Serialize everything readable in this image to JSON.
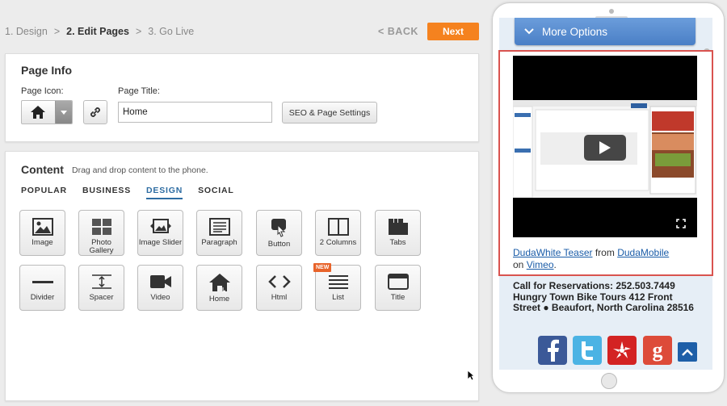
{
  "steps": {
    "step1": "1. Design",
    "sep1": ">",
    "step2": "2. Edit Pages",
    "sep2": ">",
    "step3": "3. Go Live"
  },
  "nav": {
    "back": "< BACK",
    "next": "Next"
  },
  "page_info": {
    "title": "Page Info",
    "icon_label": "Page Icon:",
    "title_label": "Page Title:",
    "title_value": "Home",
    "seo_button": "SEO & Page Settings"
  },
  "content": {
    "title": "Content",
    "subtitle": "Drag and drop content to the phone.",
    "tabs": [
      "POPULAR",
      "BUSINESS",
      "DESIGN",
      "SOCIAL"
    ],
    "active_tab": "DESIGN",
    "widgets": [
      {
        "label": "Image",
        "icon": "image-icon"
      },
      {
        "label": "Photo Gallery",
        "icon": "photo-gallery-icon"
      },
      {
        "label": "Image Slider",
        "icon": "image-slider-icon"
      },
      {
        "label": "Paragraph",
        "icon": "paragraph-icon"
      },
      {
        "label": "Button",
        "icon": "button-hand-icon"
      },
      {
        "label": "2 Columns",
        "icon": "two-columns-icon"
      },
      {
        "label": "Tabs",
        "icon": "tabs-icon"
      },
      {
        "label": "Divider",
        "icon": "divider-icon"
      },
      {
        "label": "Spacer",
        "icon": "spacer-icon"
      },
      {
        "label": "Video",
        "icon": "video-camera-icon"
      },
      {
        "label": "Home",
        "icon": "home-icon"
      },
      {
        "label": "Html",
        "icon": "code-icon"
      },
      {
        "label": "List",
        "icon": "list-icon",
        "badge": "NEW"
      },
      {
        "label": "Title",
        "icon": "title-icon"
      }
    ]
  },
  "phone": {
    "more_options": "More Options",
    "video_caption": {
      "title_link": "DudaWhite Teaser",
      "from": "from",
      "author_link": "DudaMobile",
      "on": "on",
      "site_link": "Vimeo",
      "end": "."
    },
    "call_text": "Call for Reservations: 252.503.7449 Hungry Town Bike Tours 412 Front Street ● Beaufort, North Carolina 28516",
    "social": [
      "facebook-icon",
      "twitter-icon",
      "yelp-icon",
      "google-icon"
    ]
  },
  "colors": {
    "accent_orange": "#f5821f",
    "tab_blue": "#2d6ca2",
    "more_options_blue": "#5a8ed2",
    "highlight_red": "#d9534f"
  }
}
